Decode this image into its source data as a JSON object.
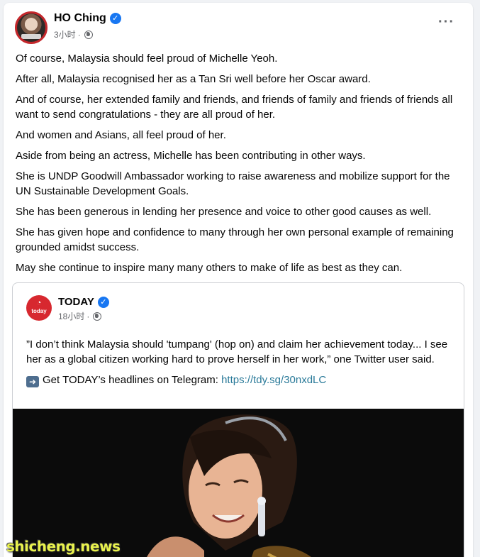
{
  "post": {
    "author": "HO Ching",
    "time": "3小时",
    "paragraphs": [
      "Of course, Malaysia should feel proud of Michelle Yeoh.",
      "After all, Malaysia recognised her as a Tan Sri well before her Oscar award.",
      "And of course, her extended family and friends, and friends of family and friends of friends all want to send congratulations - they are all proud of her.",
      "And women and Asians, all feel proud of her.",
      "Aside from being an actress, Michelle has been contributing in other ways.",
      "She is UNDP Goodwill Ambassador working to raise awareness and mobilize support for the UN Sustainable Development Goals.",
      "She has been generous in lending her presence and voice to other good causes as well.",
      "She has given hope and confidence to many through her own personal example of remaining grounded amidst success.",
      "May she continue to inspire many many others to make of life as best as they can."
    ]
  },
  "shared": {
    "author": "TODAY",
    "avatar_text": "today",
    "time": "18小时",
    "quote": "”I don’t think Malaysia should 'tumpang' (hop on) and claim her achievement today... I see her as a global citizen working hard to prove herself in her work,” one Twitter user said.",
    "cta_prefix": "Get TODAY’s headlines on Telegram:",
    "cta_link": "https://tdy.sg/30nxdLC"
  },
  "watermark": "shicheng.news",
  "icons": {
    "verified": "verified-badge-icon",
    "globe": "globe-icon",
    "more": "more-options-icon",
    "arrow": "right-arrow-icon"
  },
  "colors": {
    "verified": "#1877f2",
    "today_brand": "#d7282f",
    "link": "#2a7a99",
    "watermark": "#e9f24d"
  }
}
